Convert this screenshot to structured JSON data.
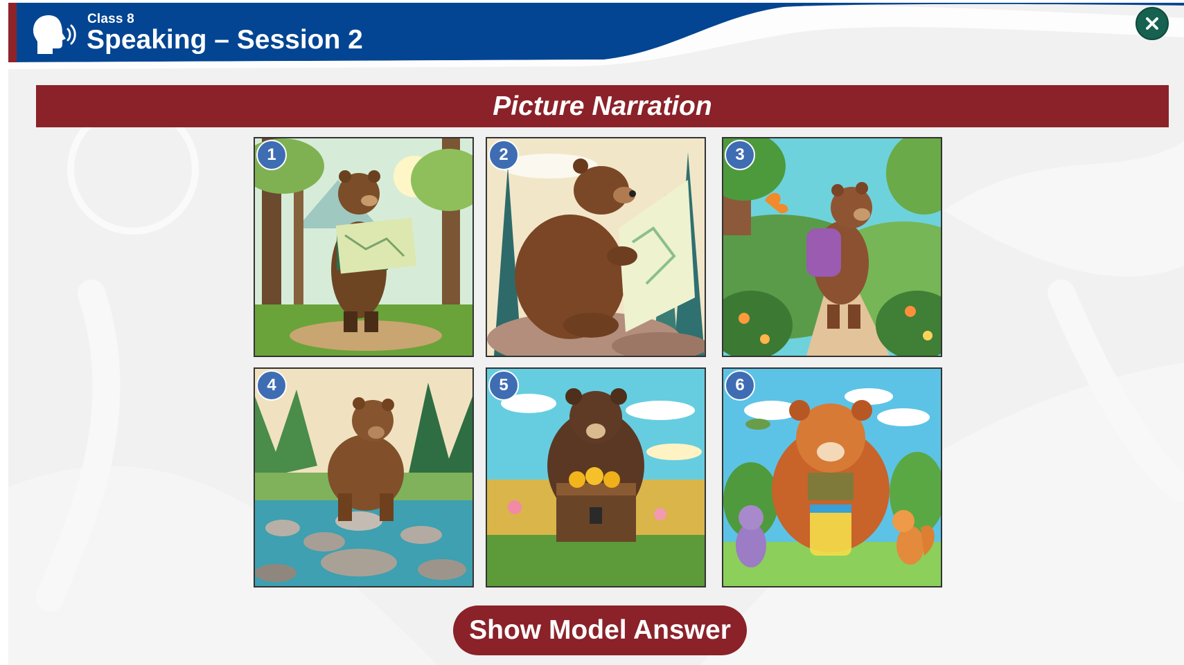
{
  "header": {
    "class_label": "Class 8",
    "session_title": "Speaking – Session 2",
    "header_color": "#034592",
    "stripe_color": "#8e2329",
    "speaker_icon": "speaking-head-icon",
    "close_icon": "close-icon",
    "close_color": "#16614f"
  },
  "activity": {
    "title": "Picture Narration",
    "banner_color": "#8b2229"
  },
  "pictures": [
    {
      "number": "1",
      "scene": "bear-reading-map-in-forest"
    },
    {
      "number": "2",
      "scene": "bear-sitting-on-rock-with-map"
    },
    {
      "number": "3",
      "scene": "bear-walking-with-backpack"
    },
    {
      "number": "4",
      "scene": "bear-crossing-river-stones"
    },
    {
      "number": "5",
      "scene": "bear-with-treasure-chest"
    },
    {
      "number": "6",
      "scene": "bear-sharing-honey-with-friends"
    }
  ],
  "footer": {
    "answer_button_label": "Show Model Answer"
  }
}
